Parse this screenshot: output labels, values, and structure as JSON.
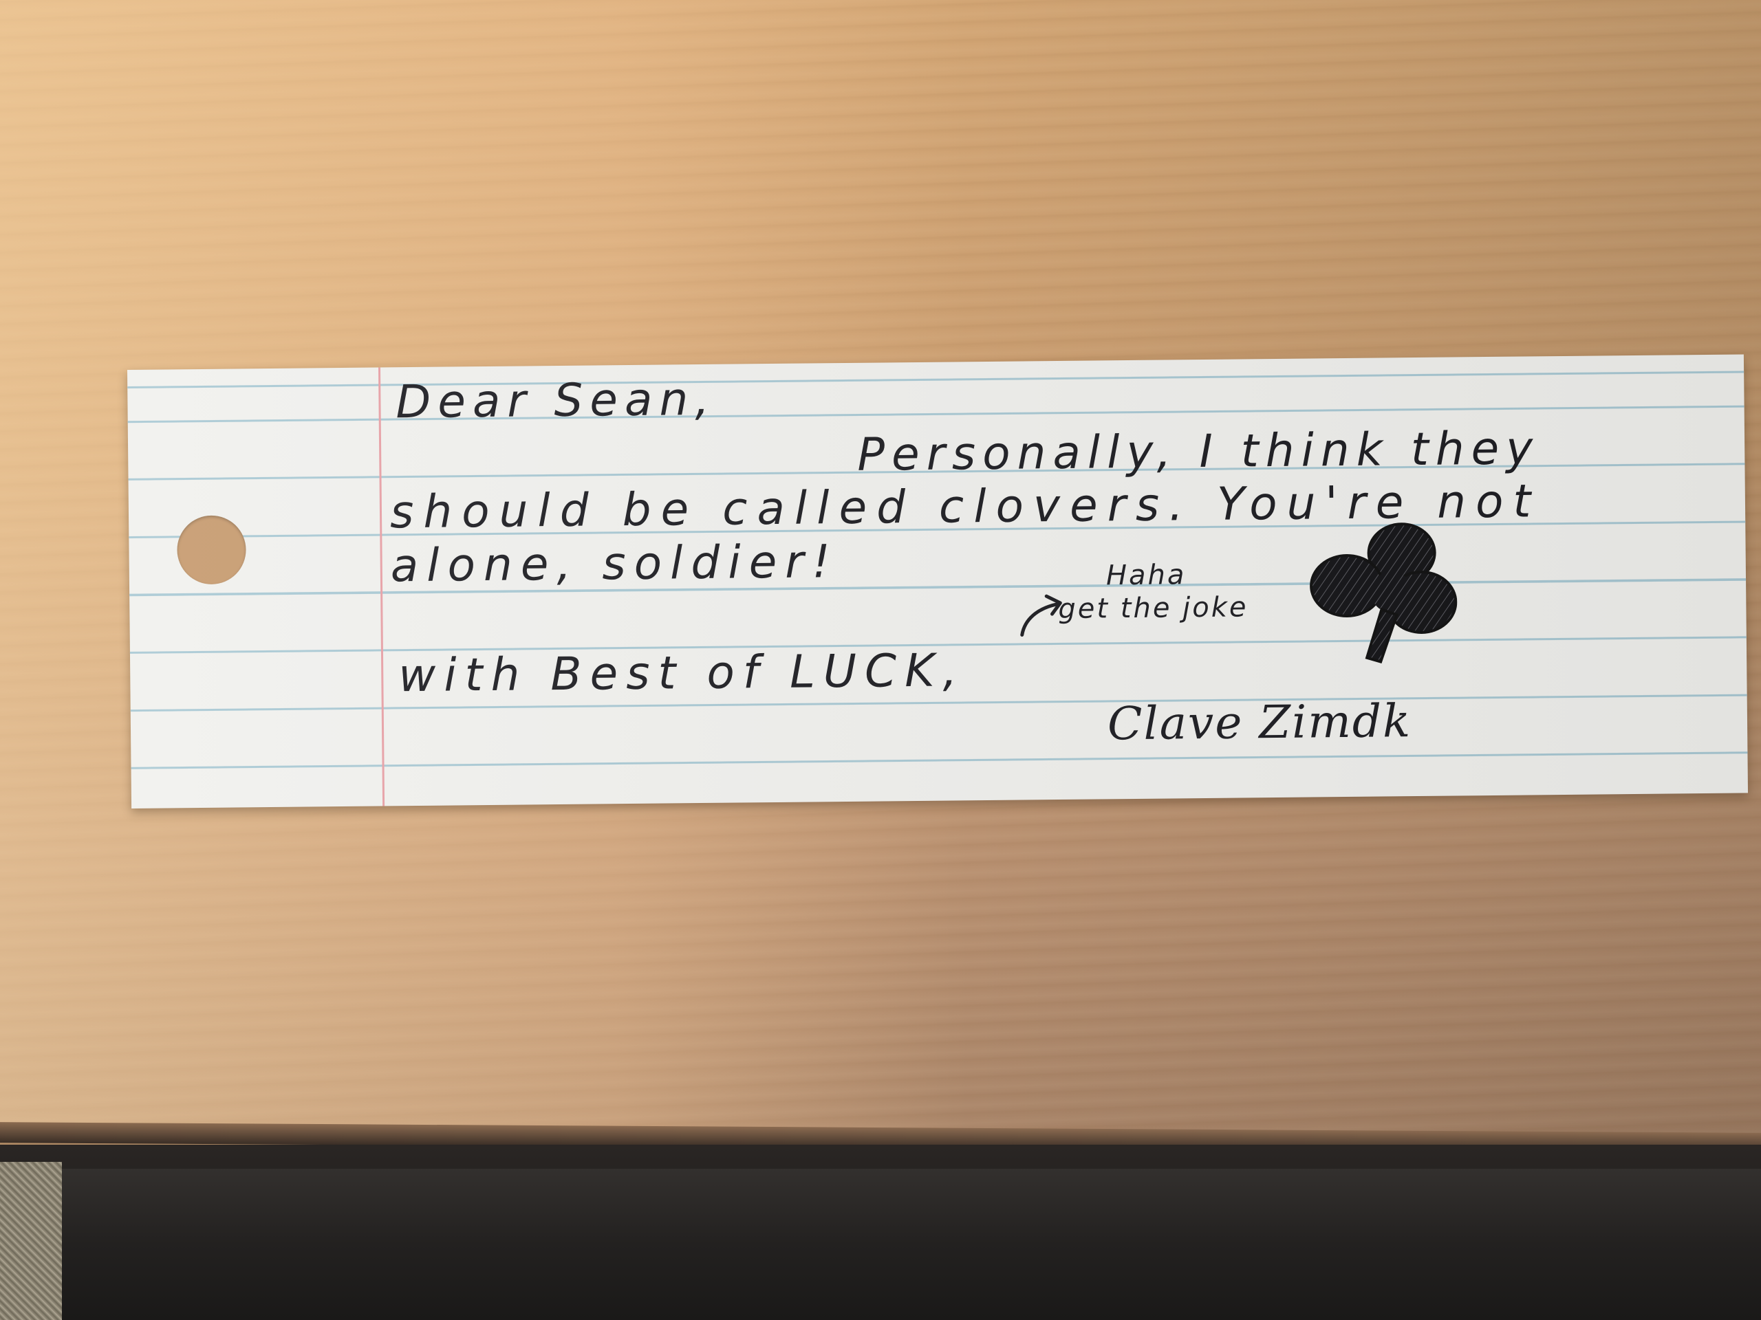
{
  "note": {
    "greeting": "Dear Sean,",
    "line1": "Personally, I think they",
    "line2": "should be called clovers. You're not",
    "line3": "alone, soldier!",
    "closing": "with Best of LUCK,",
    "aside_line1": "Haha",
    "aside_line2": "get the joke",
    "signature": "Clave Zimdk"
  },
  "colors": {
    "desk": "#c89c70",
    "card": "#f1f1ee",
    "rule_line": "#a9c9d4",
    "margin_line": "#e8a0a6",
    "ink": "#1d1d22"
  },
  "icons": {
    "drawing": "club-icon",
    "pointer": "arrow-icon"
  }
}
